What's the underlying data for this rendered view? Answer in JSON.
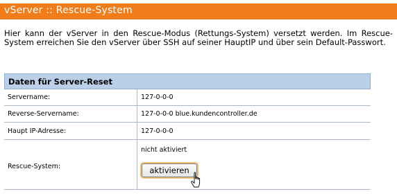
{
  "header": {
    "title": "vServer :: Rescue-System",
    "bar_color": "#f07d1a"
  },
  "intro": {
    "text": "Hier kann der vServer in den Rescue-Modus (Rettungs-System) versetzt werden. Im Rescue-System erreichen Sie den vServer über SSH auf seiner HauptIP und über sein Default-Passwort."
  },
  "panel": {
    "title": "Daten für Server-Reset",
    "header_color": "#b9d0e8",
    "rows": [
      {
        "label": "Servername:",
        "value": "127-0-0-0"
      },
      {
        "label": "Reverse-Servername:",
        "value": "127-0-0-0 blue.kundencontroller.de"
      },
      {
        "label": "Haupt IP-Adresse:",
        "value": "127-0-0-0"
      }
    ],
    "rescue": {
      "label": "Rescue-System:",
      "status": "nicht aktiviert",
      "button_label": "aktivieren"
    }
  },
  "cursor": {
    "icon": "pointer-hand-icon"
  }
}
